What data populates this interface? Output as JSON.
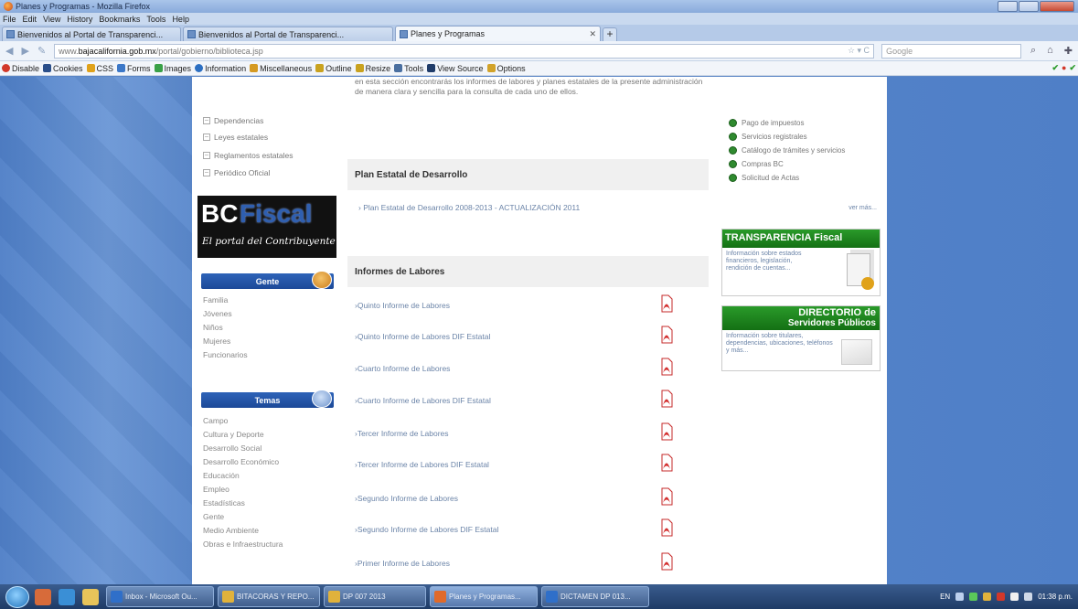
{
  "window": {
    "title": "Planes y Programas - Mozilla Firefox"
  },
  "menubar": [
    "File",
    "Edit",
    "View",
    "History",
    "Bookmarks",
    "Tools",
    "Help"
  ],
  "tabs": [
    {
      "label": "Bienvenidos al Portal de Transparenci...",
      "active": false
    },
    {
      "label": "Bienvenidos al Portal de Transparenci...",
      "active": false
    },
    {
      "label": "Planes y Programas",
      "active": true
    }
  ],
  "navbar": {
    "url_prefix": "www.",
    "url_domain": "bajacalifornia.gob.mx",
    "url_path": "/portal/gobierno/biblioteca.jsp",
    "search_placeholder": "Google"
  },
  "devbar": [
    {
      "label": "Disable",
      "color": "#d2382a"
    },
    {
      "label": "Cookies",
      "color": "#2b4f8a"
    },
    {
      "label": "CSS",
      "color": "#e0a21a"
    },
    {
      "label": "Forms",
      "color": "#3c78c8"
    },
    {
      "label": "Images",
      "color": "#39a047"
    },
    {
      "label": "Information",
      "color": "#2c6fc2"
    },
    {
      "label": "Miscellaneous",
      "color": "#d59a22"
    },
    {
      "label": "Outline",
      "color": "#c9a21f"
    },
    {
      "label": "Resize",
      "color": "#c9a21f"
    },
    {
      "label": "Tools",
      "color": "#4a6fa0"
    },
    {
      "label": "View Source",
      "color": "#203c6a"
    },
    {
      "label": "Options",
      "color": "#d2a32a"
    }
  ],
  "left": {
    "links": [
      "Dependencias",
      "Leyes estatales",
      "Reglamentos estatales",
      "Periódico Oficial"
    ],
    "bcfiscal": {
      "bc": "BC",
      "fiscal": "Fiscal",
      "tagline": "El portal del Contribuyente"
    },
    "gente": {
      "title": "Gente",
      "items": [
        "Familia",
        "Jóvenes",
        "Niños",
        "Mujeres",
        "Funcionarios"
      ]
    },
    "temas": {
      "title": "Temas",
      "items": [
        "Campo",
        "Cultura y Deporte",
        "Desarrollo Social",
        "Desarrollo Económico",
        "Educación",
        "Empleo",
        "Estadísticas",
        "Gente",
        "Medio Ambiente",
        "Obras e Infraestructura"
      ]
    }
  },
  "main": {
    "intro": "en esta sección encontrarás los informes de labores y planes estatales de la presente administración de manera clara y sencilla para la consulta de cada uno de ellos.",
    "plan_heading": "Plan Estatal de Desarrollo",
    "plan_link": "Plan Estatal de Desarrollo 2008-2013 - ACTUALIZACIÓN 2011",
    "informes_heading": "Informes de Labores",
    "reports": [
      "Quinto Informe de Labores",
      "Quinto Informe de Labores DIF Estatal",
      "Cuarto Informe de Labores",
      "Cuarto Informe de Labores DIF Estatal",
      "Tercer Informe de Labores",
      "Tercer Informe de Labores DIF Estatal",
      "Segundo Informe de Labores",
      "Segundo Informe de Labores DIF Estatal",
      "Primer Informe de Labores"
    ]
  },
  "right": {
    "services": [
      "Pago de impuestos",
      "Servicios registrales",
      "Catálogo de trámites y servicios",
      "Compras BC",
      "Solicitud de Actas"
    ],
    "ver_mas": "ver más...",
    "transparencia": {
      "title": "TRANSPARENCIA Fiscal",
      "text": "Información sobre estados financieros, legislación, rendición de cuentas..."
    },
    "directorio": {
      "title1": "DIRECTORIO de",
      "title2": "Servidores Públicos",
      "text": "Información sobre titulares, dependencias, ubicaciones, teléfonos y más..."
    }
  },
  "taskbar": {
    "tasks": [
      {
        "label": "Inbox - Microsoft Ou...",
        "color": "#2f6fc9",
        "active": false
      },
      {
        "label": "BITACORAS Y REPO...",
        "color": "#e0b23c",
        "active": false
      },
      {
        "label": "DP 007 2013",
        "color": "#e0b23c",
        "active": false
      },
      {
        "label": "Planes y Programas...",
        "color": "#e06a2a",
        "active": true
      },
      {
        "label": "DICTAMEN DP 013...",
        "color": "#2f6fc9",
        "active": false
      }
    ],
    "language": "EN",
    "clock": "01:38 p.m."
  },
  "colors": {
    "accent_blue": "#1c4998",
    "green_banner": "#147014",
    "page_background": "#4f7fc7"
  }
}
